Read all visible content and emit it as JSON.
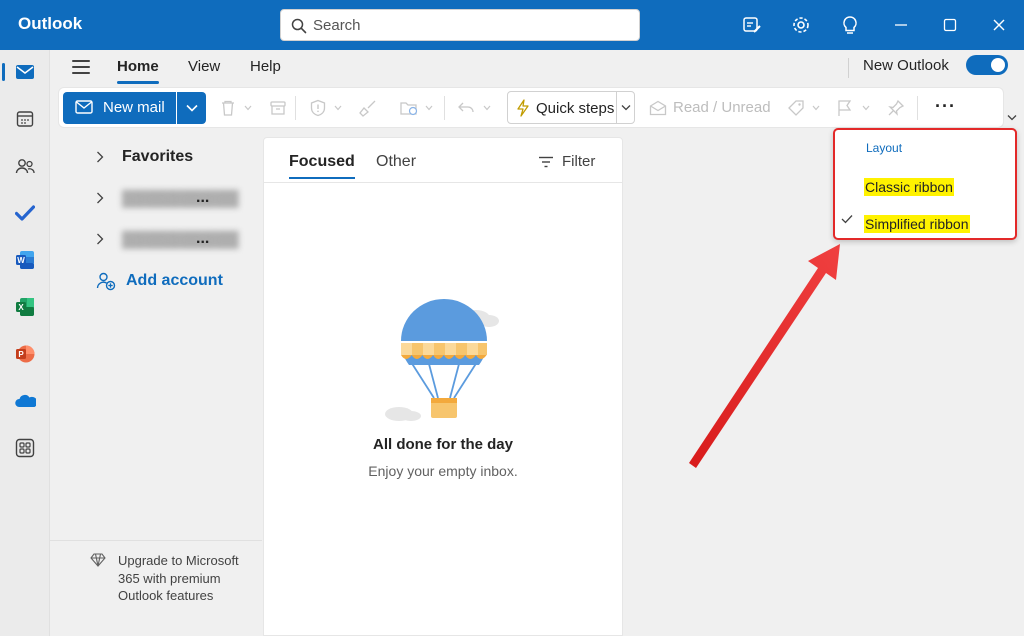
{
  "app": {
    "title": "Outlook"
  },
  "search": {
    "placeholder": "Search"
  },
  "titlebar_icons": [
    "edit-notes-icon",
    "gear-icon",
    "lightbulb-icon",
    "minimize-icon",
    "maximize-icon",
    "close-icon"
  ],
  "rail": [
    "mail-icon",
    "calendar-icon",
    "people-icon",
    "todo-icon",
    "word-icon",
    "excel-icon",
    "powerpoint-icon",
    "onedrive-icon",
    "apps-icon"
  ],
  "tabs": {
    "home": "Home",
    "view": "View",
    "help": "Help"
  },
  "new_outlook": {
    "label": "New Outlook",
    "enabled": true
  },
  "ribbon": {
    "new_mail": "New mail",
    "quick_steps": "Quick steps",
    "read_unread": "Read / Unread",
    "more": "···"
  },
  "folders": {
    "favorites": "Favorites",
    "account1_dots": "...",
    "account2_dots": "...",
    "add_account": "Add account"
  },
  "upgrade": {
    "text": "Upgrade to Microsoft 365 with premium Outlook features"
  },
  "message_list": {
    "focused": "Focused",
    "other": "Other",
    "filter": "Filter",
    "empty_title": "All done for the day",
    "empty_subtitle": "Enjoy your empty inbox."
  },
  "layout_menu": {
    "header": "Layout",
    "items": [
      {
        "label": "Classic ribbon",
        "checked": false
      },
      {
        "label": "Simplified ribbon",
        "checked": true
      }
    ]
  },
  "colors": {
    "brand": "#0f6cbd",
    "highlight": "#fff200",
    "annotation": "#e32929"
  }
}
